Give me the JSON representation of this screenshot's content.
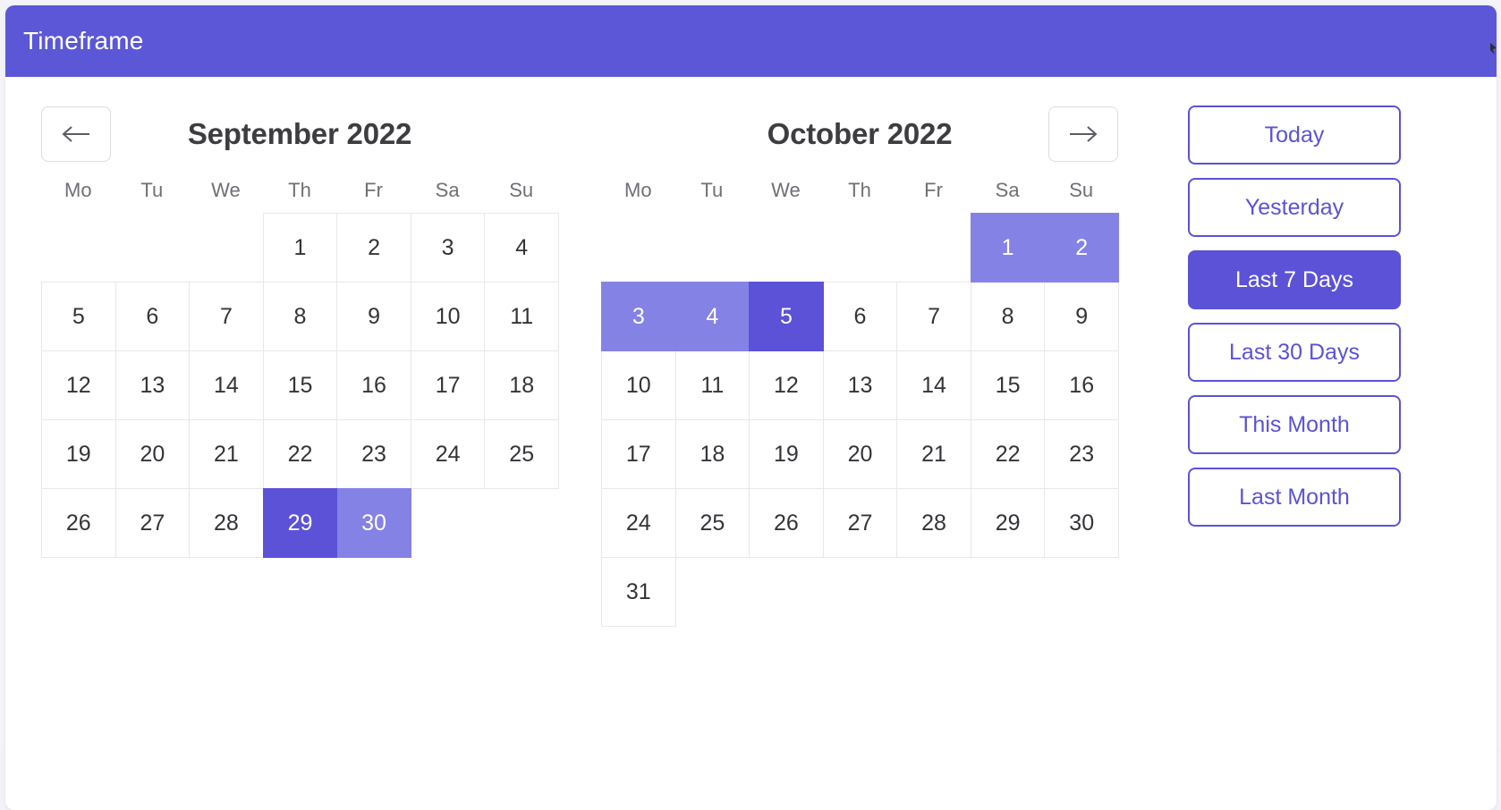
{
  "header": {
    "title": "Timeframe",
    "background_color": "#5b57d6"
  },
  "colors": {
    "accent": "#5b52d8",
    "range": "#8582e6",
    "cell_border": "#e8e8ec",
    "nav_border": "#dcdce2",
    "text": "#343438"
  },
  "nav": {
    "prev_icon": "arrow-left-icon",
    "next_icon": "arrow-right-icon"
  },
  "weekdays": [
    "Mo",
    "Tu",
    "We",
    "Th",
    "Fr",
    "Sa",
    "Su"
  ],
  "calendars": [
    {
      "title": "September 2022",
      "leading_blanks": 3,
      "days": [
        {
          "n": "1",
          "state": "normal"
        },
        {
          "n": "2",
          "state": "normal"
        },
        {
          "n": "3",
          "state": "normal"
        },
        {
          "n": "4",
          "state": "normal"
        },
        {
          "n": "5",
          "state": "normal"
        },
        {
          "n": "6",
          "state": "normal"
        },
        {
          "n": "7",
          "state": "normal"
        },
        {
          "n": "8",
          "state": "normal"
        },
        {
          "n": "9",
          "state": "normal"
        },
        {
          "n": "10",
          "state": "normal"
        },
        {
          "n": "11",
          "state": "normal"
        },
        {
          "n": "12",
          "state": "normal"
        },
        {
          "n": "13",
          "state": "normal"
        },
        {
          "n": "14",
          "state": "normal"
        },
        {
          "n": "15",
          "state": "normal"
        },
        {
          "n": "16",
          "state": "normal"
        },
        {
          "n": "17",
          "state": "normal"
        },
        {
          "n": "18",
          "state": "normal"
        },
        {
          "n": "19",
          "state": "normal"
        },
        {
          "n": "20",
          "state": "normal"
        },
        {
          "n": "21",
          "state": "normal"
        },
        {
          "n": "22",
          "state": "normal"
        },
        {
          "n": "23",
          "state": "normal"
        },
        {
          "n": "24",
          "state": "normal"
        },
        {
          "n": "25",
          "state": "normal"
        },
        {
          "n": "26",
          "state": "normal"
        },
        {
          "n": "27",
          "state": "normal"
        },
        {
          "n": "28",
          "state": "normal"
        },
        {
          "n": "29",
          "state": "selected"
        },
        {
          "n": "30",
          "state": "range"
        }
      ]
    },
    {
      "title": "October 2022",
      "leading_blanks": 5,
      "days": [
        {
          "n": "1",
          "state": "range"
        },
        {
          "n": "2",
          "state": "range"
        },
        {
          "n": "3",
          "state": "range"
        },
        {
          "n": "4",
          "state": "range"
        },
        {
          "n": "5",
          "state": "selected"
        },
        {
          "n": "6",
          "state": "normal"
        },
        {
          "n": "7",
          "state": "normal"
        },
        {
          "n": "8",
          "state": "normal"
        },
        {
          "n": "9",
          "state": "normal"
        },
        {
          "n": "10",
          "state": "normal"
        },
        {
          "n": "11",
          "state": "normal"
        },
        {
          "n": "12",
          "state": "normal"
        },
        {
          "n": "13",
          "state": "normal"
        },
        {
          "n": "14",
          "state": "normal"
        },
        {
          "n": "15",
          "state": "normal"
        },
        {
          "n": "16",
          "state": "normal"
        },
        {
          "n": "17",
          "state": "normal"
        },
        {
          "n": "18",
          "state": "normal"
        },
        {
          "n": "19",
          "state": "normal"
        },
        {
          "n": "20",
          "state": "normal"
        },
        {
          "n": "21",
          "state": "normal"
        },
        {
          "n": "22",
          "state": "normal"
        },
        {
          "n": "23",
          "state": "normal"
        },
        {
          "n": "24",
          "state": "normal"
        },
        {
          "n": "25",
          "state": "normal"
        },
        {
          "n": "26",
          "state": "normal"
        },
        {
          "n": "27",
          "state": "normal"
        },
        {
          "n": "28",
          "state": "normal"
        },
        {
          "n": "29",
          "state": "normal"
        },
        {
          "n": "30",
          "state": "normal"
        },
        {
          "n": "31",
          "state": "normal"
        }
      ]
    }
  ],
  "presets": [
    {
      "label": "Today",
      "active": false
    },
    {
      "label": "Yesterday",
      "active": false
    },
    {
      "label": "Last 7 Days",
      "active": true
    },
    {
      "label": "Last 30 Days",
      "active": false
    },
    {
      "label": "This Month",
      "active": false
    },
    {
      "label": "Last Month",
      "active": false
    }
  ]
}
